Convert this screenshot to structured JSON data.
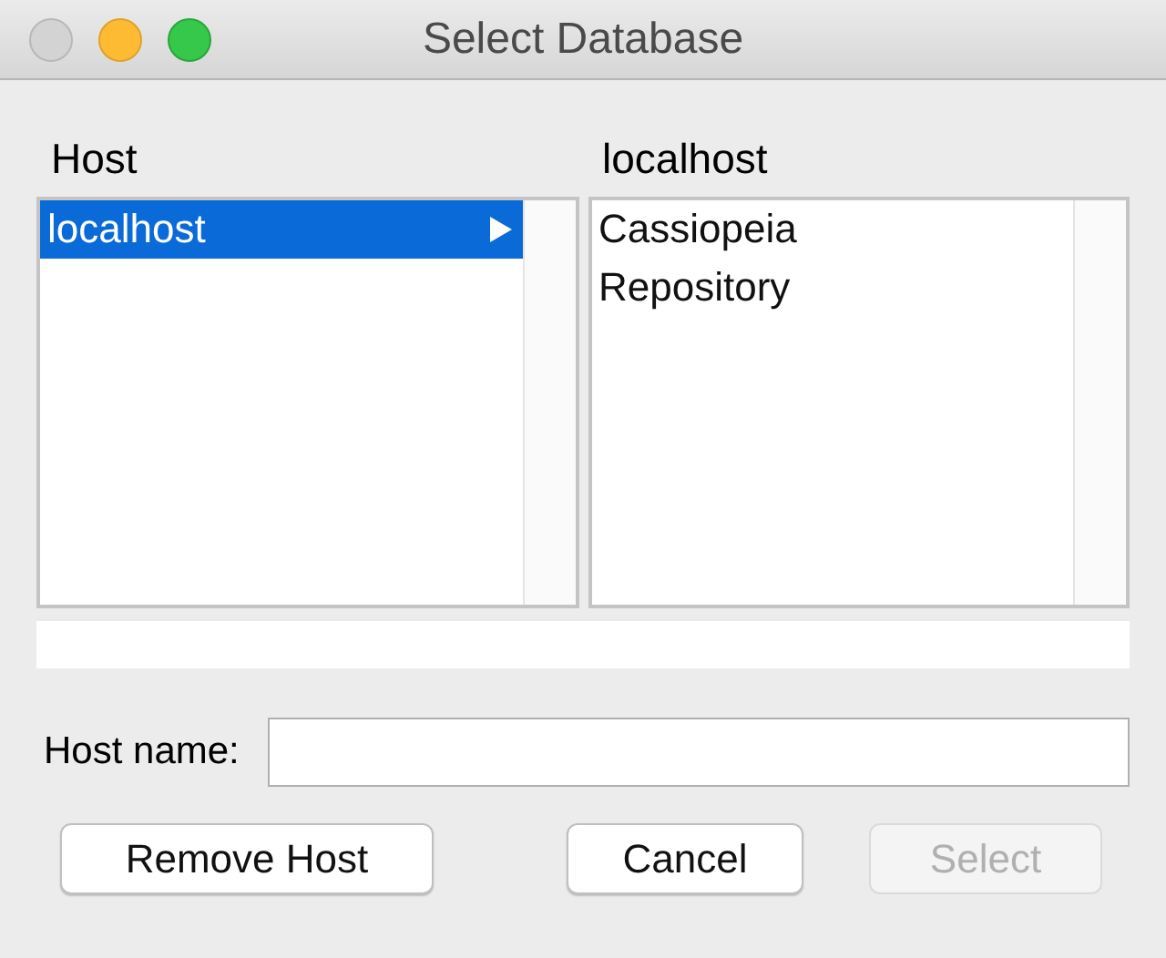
{
  "window": {
    "title": "Select Database"
  },
  "columns": [
    {
      "heading": "Host",
      "items": [
        {
          "label": "localhost",
          "selected": true,
          "has_children": true
        }
      ]
    },
    {
      "heading": "localhost",
      "items": [
        {
          "label": "Cassiopeia",
          "selected": false,
          "has_children": false
        },
        {
          "label": "Repository",
          "selected": false,
          "has_children": false
        }
      ]
    }
  ],
  "host_name": {
    "label": "Host name:"
  },
  "buttons": [
    {
      "label": "Remove Host",
      "disabled": false
    },
    {
      "label": "Cancel",
      "disabled": false
    },
    {
      "label": "Select",
      "disabled": true
    }
  ]
}
